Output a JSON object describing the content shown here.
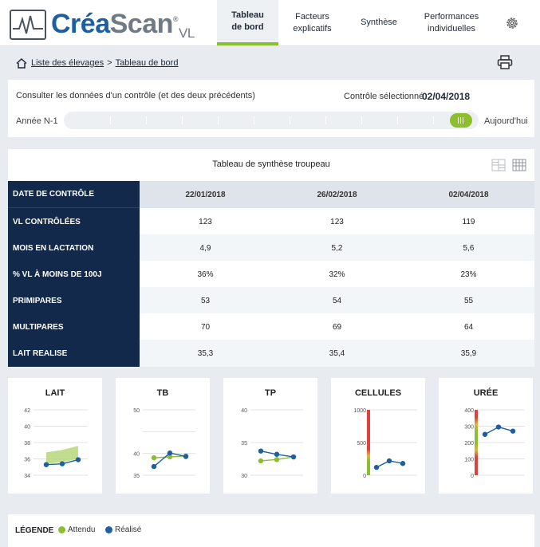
{
  "app": {
    "logo_crea": "Créa",
    "logo_scan": "Scan",
    "logo_reg": "®",
    "logo_sub": "VL"
  },
  "nav": [
    {
      "line1": "Tableau",
      "line2": "de bord",
      "active": true
    },
    {
      "line1": "Facteurs",
      "line2": "explicatifs",
      "active": false
    },
    {
      "line1": "Synthèse",
      "line2": "",
      "active": false
    },
    {
      "line1": "Performances",
      "line2": "individuelles",
      "active": false
    }
  ],
  "breadcrumb": {
    "home_label": "Liste des élevages",
    "separator": ">",
    "current": "Tableau de bord"
  },
  "controle": {
    "description": "Consulter les données d'un contrôle (et des deux précédents)",
    "selected_label": "Contrôle sélectionné",
    "selected_value": "02/04/2018",
    "year_left": "Année N-1",
    "year_right": "Aujourd'hui"
  },
  "table": {
    "title": "Tableau de synthèse troupeau",
    "rows": [
      {
        "label": "DATE DE CONTRÔLE",
        "values": [
          "22/01/2018",
          "26/02/2018",
          "02/04/2018"
        ]
      },
      {
        "label": "VL CONTRÔLÉES",
        "values": [
          "123",
          "123",
          "119"
        ]
      },
      {
        "label": "MOIS EN LACTATION",
        "values": [
          "4,9",
          "5,2",
          "5,6"
        ]
      },
      {
        "label": "% VL À MOINS DE 100J",
        "values": [
          "36%",
          "32%",
          "23%"
        ]
      },
      {
        "label": "PRIMIPARES",
        "values": [
          "53",
          "54",
          "55"
        ]
      },
      {
        "label": "MULTIPARES",
        "values": [
          "70",
          "69",
          "64"
        ]
      },
      {
        "label": "LAIT REALISE",
        "values": [
          "35,3",
          "35,4",
          "35,9"
        ]
      }
    ]
  },
  "colors": {
    "navy": "#13294b",
    "green": "#8dbe2d",
    "blue": "#1d5fa0",
    "band": "#b7d77a"
  },
  "chart_data": [
    {
      "type": "line",
      "title": "LAIT",
      "yticks": [
        "42",
        "40",
        "38",
        "36",
        "34"
      ],
      "series": [
        {
          "name": "Réalisé",
          "values": [
            35.3,
            35.4,
            35.9
          ]
        }
      ],
      "band": {
        "lower": [
          35.4,
          35.6,
          36.0
        ],
        "upper": [
          36.8,
          37.1,
          37.6
        ]
      }
    },
    {
      "type": "line",
      "title": "TB",
      "yticks": [
        "50",
        "",
        "40",
        "35"
      ],
      "series": [
        {
          "name": "Attendu",
          "values": [
            39.0,
            39.2,
            39.4
          ]
        },
        {
          "name": "Réalisé",
          "values": [
            37.0,
            40.1,
            39.3
          ]
        }
      ]
    },
    {
      "type": "line",
      "title": "TP",
      "yticks": [
        "40",
        "35",
        "30"
      ],
      "series": [
        {
          "name": "Attendu",
          "values": [
            32.2,
            32.4,
            32.8
          ]
        },
        {
          "name": "Réalisé",
          "values": [
            33.7,
            33.2,
            32.8
          ]
        }
      ]
    },
    {
      "type": "line",
      "title": "CELLULES",
      "yticks": [
        "1000",
        "500",
        "0"
      ],
      "series": [
        {
          "name": "Réalisé",
          "values": [
            120,
            220,
            180
          ]
        }
      ]
    },
    {
      "type": "line",
      "title": "URÉE",
      "yticks": [
        "400",
        "300",
        "200",
        "100",
        "0"
      ],
      "series": [
        {
          "name": "Réalisé",
          "values": [
            250,
            295,
            270
          ]
        }
      ]
    }
  ],
  "legend": {
    "title": "LÉGENDE",
    "items": [
      {
        "label": "Attendu",
        "color": "#8dbe2d"
      },
      {
        "label": "Réalisé",
        "color": "#1d5fa0"
      }
    ]
  }
}
